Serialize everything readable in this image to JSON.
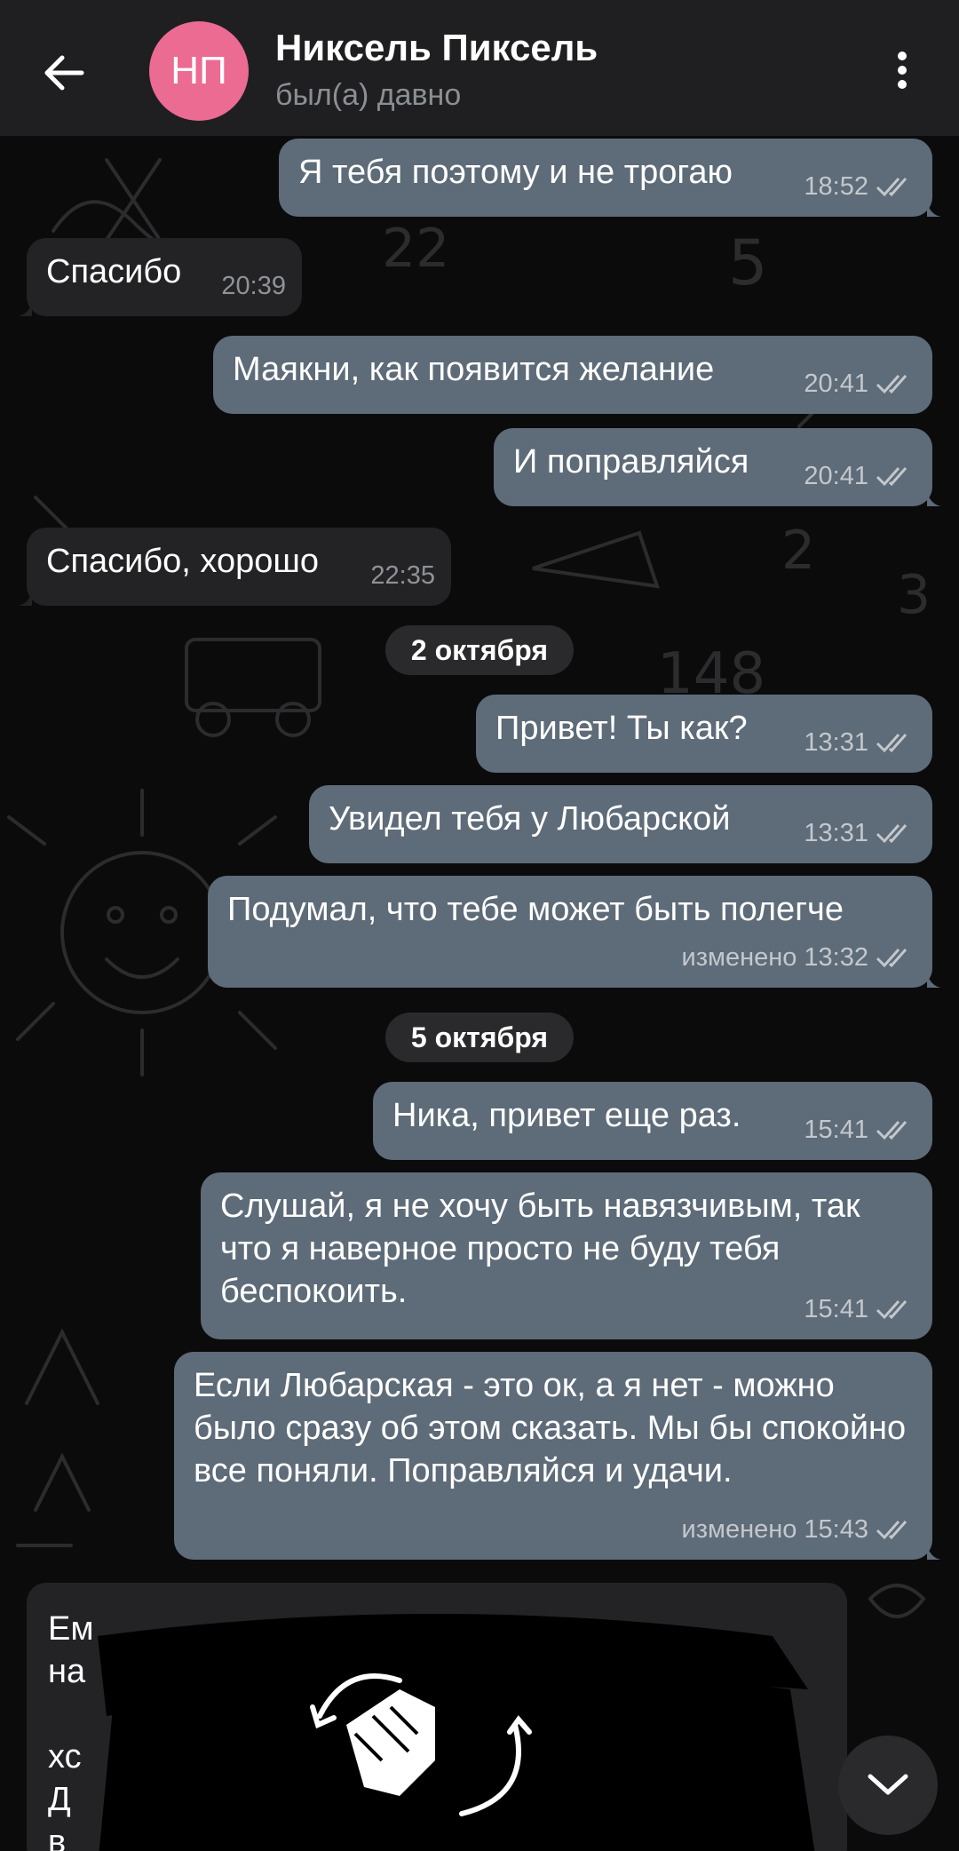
{
  "header": {
    "avatar_initials": "НП",
    "avatar_color": "#ec6b93",
    "contact_name": "Никсель Пиксель",
    "status": "был(а) давно",
    "back_icon": "arrow-left-icon",
    "menu_icon": "more-vertical-icon"
  },
  "messages": [
    {
      "dir": "out",
      "text": "Я тебя поэтому и не трогаю",
      "time": "18:52",
      "read": true
    },
    {
      "dir": "in",
      "text": "Спасибо",
      "time": "20:39"
    },
    {
      "dir": "out",
      "text": "Маякни, как появится желание",
      "time": "20:41",
      "read": true
    },
    {
      "dir": "out",
      "text": "И поправляйся",
      "time": "20:41",
      "read": true
    },
    {
      "dir": "in",
      "text": "Спасибо, хорошо",
      "time": "22:35"
    },
    {
      "dir": "out",
      "text": "Привет! Ты как?",
      "time": "13:31",
      "read": true
    },
    {
      "dir": "out",
      "text": "Увидел тебя у Любарской",
      "time": "13:31",
      "read": true
    },
    {
      "dir": "out",
      "text": "Подумал, что тебе может быть полегче",
      "time": "изменено 13:32",
      "read": true
    },
    {
      "dir": "out",
      "text": "Ника, привет еще раз.",
      "time": "15:41",
      "read": true
    },
    {
      "dir": "out",
      "text": "Слушай, я не хочу быть навязчивым, так что я наверное просто не буду тебя беспокоить.",
      "time": "15:41",
      "read": true
    },
    {
      "dir": "out",
      "text": "Если Любарская - это ок, а я нет - можно было сразу об этом сказать. Мы бы спокойно все поняли. Поправляйся и удачи.",
      "time": "изменено 15:43",
      "read": true
    }
  ],
  "date_separators": [
    "2 октября",
    "5 октября"
  ],
  "redacted_message": {
    "visible_fragments": [
      "Ем",
      "на",
      "хс",
      "Д",
      "в"
    ]
  },
  "scroll_down_icon": "chevron-down-icon",
  "colors": {
    "header_bg": "#1f1f21",
    "outgoing_bubble": "#5e6b78",
    "incoming_bubble": "#232326",
    "background": "#0b0b0c"
  }
}
